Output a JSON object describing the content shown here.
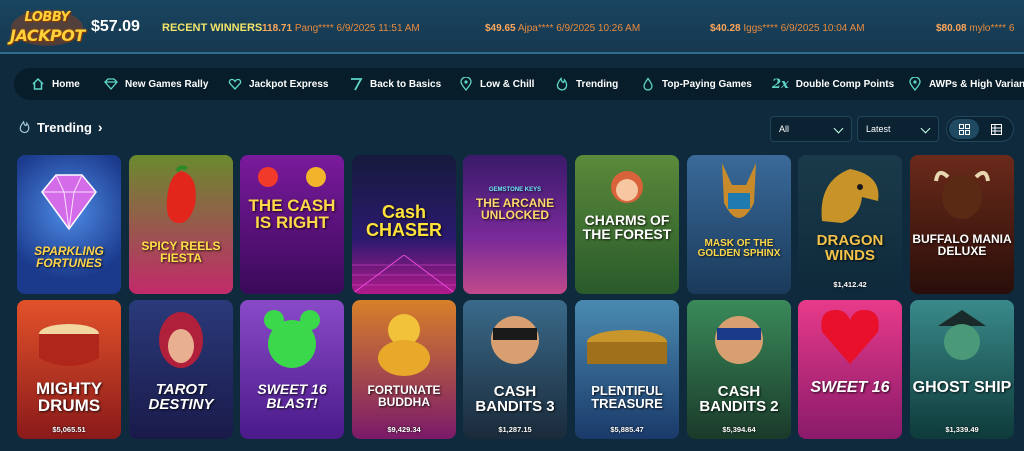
{
  "header": {
    "logo_text": "LOBBY JACKPOT",
    "balance": "$57.09",
    "recent_winners_label": "RECENT WINNERS",
    "winners": [
      {
        "amount": "118.71",
        "user": "Pang****",
        "time": "6/9/2025 11:51 AM"
      },
      {
        "amount": "$49.65",
        "user": "Ajpa****",
        "time": "6/9/2025 10:26 AM"
      },
      {
        "amount": "$40.28",
        "user": "Iggs****",
        "time": "6/9/2025 10:04 AM"
      },
      {
        "amount": "$80.08",
        "user": "mylo****",
        "time": "6"
      }
    ]
  },
  "nav": {
    "items": [
      {
        "label": "Home",
        "icon": "home-icon"
      },
      {
        "label": "New Games Rally",
        "icon": "diamond-icon"
      },
      {
        "label": "Jackpot Express",
        "icon": "heart-diamond-icon"
      },
      {
        "label": "Back to Basics",
        "icon": "seven-icon"
      },
      {
        "label": "Low & Chill",
        "icon": "pin-icon"
      },
      {
        "label": "Trending",
        "icon": "flame-icon"
      },
      {
        "label": "Top-Paying Games",
        "icon": "drop-icon"
      },
      {
        "label": "Double Comp Points",
        "icon": "2x-icon",
        "icon_text": "2x"
      },
      {
        "label": "AWPs & High Varian",
        "icon": "pin-icon"
      }
    ]
  },
  "section": {
    "title": "Trending",
    "filter_value": "All",
    "sort_value": "Latest"
  },
  "games_row1": [
    {
      "title": "SPARKLING FORTUNES",
      "jackpot": ""
    },
    {
      "title": "SPICY REELS FIESTA",
      "jackpot": ""
    },
    {
      "title": "THE CASH IS RIGHT",
      "jackpot": ""
    },
    {
      "title": "Cash CHASER",
      "jackpot": ""
    },
    {
      "title": "THE ARCANE UNLOCKED",
      "subtitle": "GEMSTONE KEYS",
      "jackpot": ""
    },
    {
      "title": "CHARMS OF THE FOREST",
      "jackpot": ""
    },
    {
      "title": "MASK OF THE GOLDEN SPHINX",
      "jackpot": ""
    },
    {
      "title": "DRAGON WINDS",
      "jackpot": "$1,412.42"
    },
    {
      "title": "BUFFALO MANIA DELUXE",
      "jackpot": ""
    }
  ],
  "games_row2": [
    {
      "title": "MIGHTY DRUMS",
      "jackpot": "$5,065.51"
    },
    {
      "title": "TAROT DESTINY",
      "jackpot": ""
    },
    {
      "title": "SWEET 16 BLAST!",
      "jackpot": ""
    },
    {
      "title": "FORTUNATE BUDDHA",
      "jackpot": "$9,429.34"
    },
    {
      "title": "CASH BANDITS 3",
      "jackpot": "$1,287.15"
    },
    {
      "title": "PLENTIFUL TREASURE",
      "jackpot": "$5,885.47"
    },
    {
      "title": "CASH BANDITS 2",
      "jackpot": "$5,394.64"
    },
    {
      "title": "SWEET 16",
      "jackpot": ""
    },
    {
      "title": "GHOST SHIP",
      "jackpot": "$1,339.49"
    }
  ],
  "colors": {
    "background": "#0e2a3c",
    "nav_bg": "#071d2a",
    "accent_teal": "#5fd8c9",
    "winner_orange": "#e98a3c",
    "label_yellow": "#f2e46a"
  }
}
